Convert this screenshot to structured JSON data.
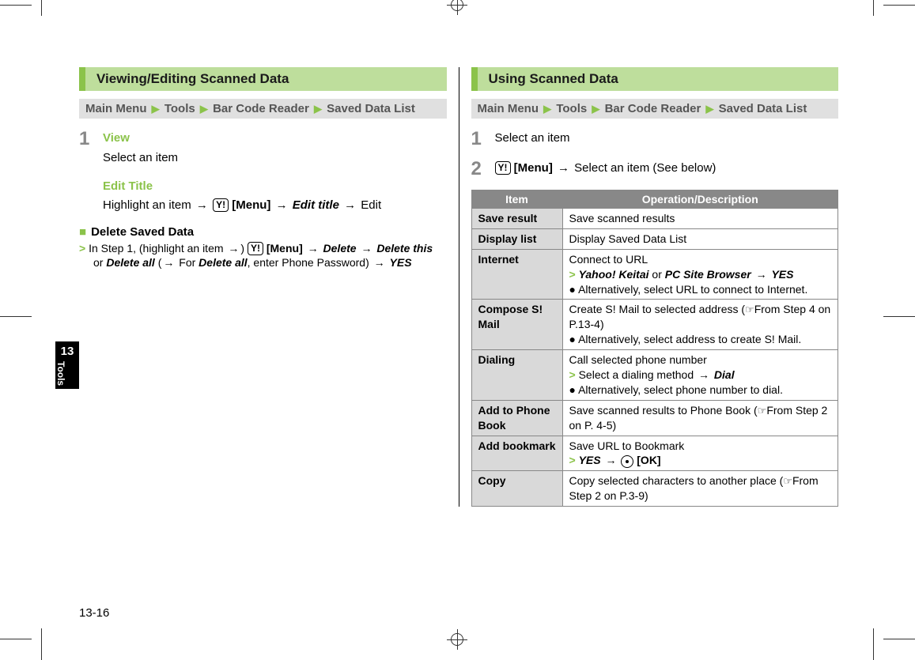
{
  "left": {
    "banner": "Viewing/Editing Scanned Data",
    "path": {
      "root": "Main Menu",
      "s1": "Tools",
      "s2": "Bar Code Reader",
      "s3": "Saved Data List"
    },
    "step1": {
      "num": "1",
      "view": "View",
      "view_text": "Select an item",
      "edit_title": "Edit Title",
      "edit_line_a": "Highlight an item",
      "menu": "[Menu]",
      "edit_title_bi": "Edit title",
      "edit_line_b": "Edit"
    },
    "delete": {
      "header": "Delete Saved Data",
      "a": "In Step 1, (highlight an item",
      "b": ")",
      "menu": "[Menu]",
      "c": "Delete",
      "d": "Delete this",
      "e": "or",
      "f": "Delete all",
      "g": "(",
      "h": "For",
      "i": "Delete all",
      "j": ", enter Phone Password)",
      "k": "YES"
    }
  },
  "right": {
    "banner": "Using Scanned Data",
    "path": {
      "root": "Main Menu",
      "s1": "Tools",
      "s2": "Bar Code Reader",
      "s3": "Saved Data List"
    },
    "step1": {
      "num": "1",
      "text": "Select an item"
    },
    "step2": {
      "num": "2",
      "menu": "[Menu]",
      "text": "Select an item (See below)"
    },
    "table": {
      "h_item": "Item",
      "h_desc": "Operation/Description",
      "rows": [
        {
          "item": "Save result",
          "line1": "Save scanned results"
        },
        {
          "item": "Display list",
          "line1": "Display Saved Data List"
        },
        {
          "item": "Internet",
          "line1": "Connect to URL",
          "chev_a": "Yahoo! Keitai",
          "mid": "or",
          "chev_b": "PC Site Browser",
          "chev_c": "YES",
          "alt": "Alternatively, select URL to connect to Internet."
        },
        {
          "item": "Compose S! Mail",
          "line1": "Create S! Mail to selected address (",
          "ref": "From Step 4 on P.13-4",
          "line1b": ")",
          "alt": "Alternatively, select address to create S! Mail."
        },
        {
          "item": "Dialing",
          "line1": "Call selected phone number",
          "chev_a": "Select a dialing method",
          "chev_b": "Dial",
          "alt": "Alternatively, select phone number to dial."
        },
        {
          "item": "Add to Phone Book",
          "line1": "Save scanned results to Phone Book (",
          "ref": "From Step 2 on P. 4-5",
          "line1b": ")"
        },
        {
          "item": "Add bookmark",
          "line1": "Save URL to Bookmark",
          "chev_a": "YES",
          "ok": "[OK]"
        },
        {
          "item": "Copy",
          "line1": "Copy selected characters to another place (",
          "ref": "From Step 2 on P.3-9",
          "line1b": ")"
        }
      ]
    }
  },
  "side": {
    "chapter": "13",
    "label": "Tools"
  },
  "page_num": "13-16",
  "glyph": {
    "arrow": "→",
    "tri": "▶"
  }
}
